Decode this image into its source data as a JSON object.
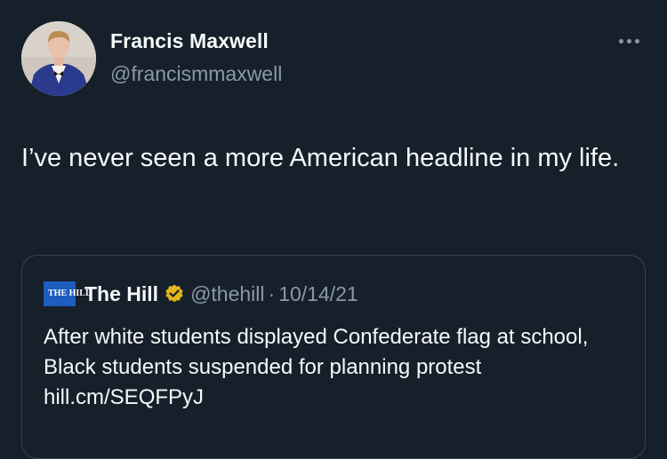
{
  "author": {
    "name": "Francis Maxwell",
    "handle": "@francismmaxwell"
  },
  "tweet": {
    "text": "I’ve never seen a more American headline in my life."
  },
  "quoted_tweet": {
    "logo_text": "THE HILL",
    "name": "The Hill",
    "verified_badge": "gold-verified-icon",
    "handle": "@thehill",
    "separator": "·",
    "date": "10/14/21",
    "text": "After white students displayed Confederate flag at school, Black students suspended for planning protest hill.cm/SEQFPyJ"
  },
  "colors": {
    "background": "#15202b",
    "text": "#f7f9f9",
    "secondary_text": "#8b98a5",
    "border": "#38444d",
    "verified_gold": "#e2b719",
    "logo_blue": "#1d5dbd"
  }
}
